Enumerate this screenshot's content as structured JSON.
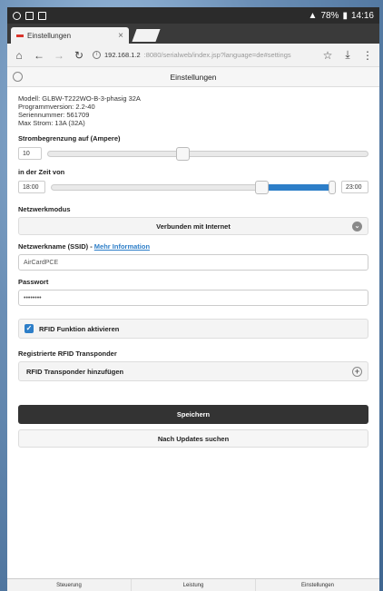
{
  "statusbar": {
    "time": "14:16",
    "battery": "78%"
  },
  "tab": {
    "title": "Einstellungen",
    "close": "×"
  },
  "urlbar": {
    "host": "192.168.1.2",
    "path": ":8080/serialweb/index.jsp?language=de#settings"
  },
  "page": {
    "title": "Einstellungen"
  },
  "device_info": [
    "Modell: GLBW-T222WO-B-3-phasig 32A",
    "Programmversion: 2.2-40",
    "Seriennummer: 561709",
    "Max Strom: 13A (32A)"
  ],
  "current_limit": {
    "label": "Strombegrenzung auf (Ampere)",
    "value": "10",
    "level_percent": 42
  },
  "time_range": {
    "label": "in der Zeit von",
    "from": "18:00",
    "to": "23:00",
    "start_percent": 74,
    "end_percent": 99
  },
  "network": {
    "mode_label": "Netzwerkmodus",
    "mode_value": "Verbunden mit Internet",
    "ssid_label": "Netzwerkname (SSID) - ",
    "ssid_link": "Mehr Information",
    "ssid_value": "AirCardPCE",
    "password_label": "Passwort",
    "password_value": "••••••••"
  },
  "rfid": {
    "activate_label": "RFID Funktion aktivieren",
    "registered_label": "Registrierte RFID Transponder",
    "add_label": "RFID Transponder hinzufügen"
  },
  "buttons": {
    "save": "Speichern",
    "updates": "Nach Updates suchen"
  },
  "footer": [
    "Steuerung",
    "Leistung",
    "Einstellungen"
  ]
}
